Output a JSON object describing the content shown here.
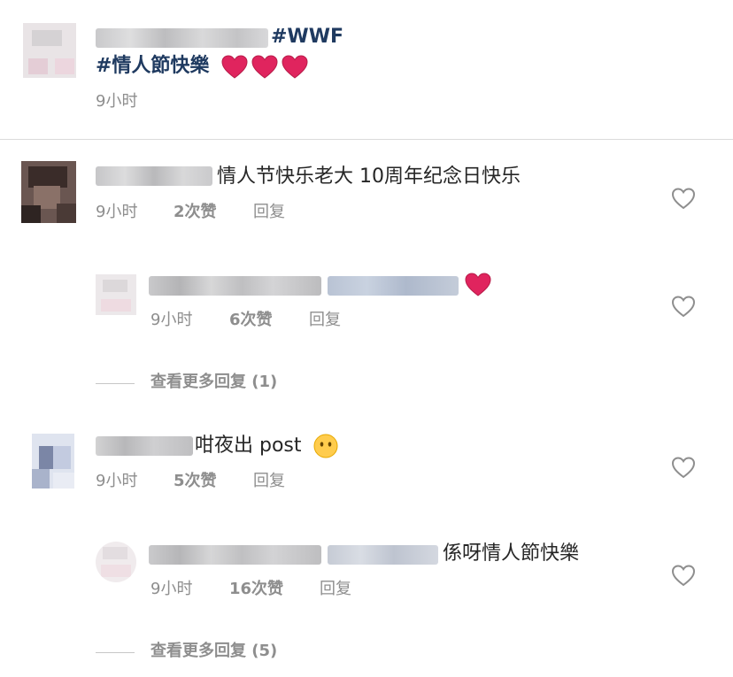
{
  "post": {
    "hashtag_wwf": "#WWF",
    "hashtag_valentine": "#情人節快樂",
    "time": "9小时"
  },
  "comments": [
    {
      "text": "情人节快乐老大 10周年纪念日快乐",
      "time": "9小时",
      "likes": "2次赞",
      "reply": "回复"
    },
    {
      "time": "9小时",
      "likes": "6次赞",
      "reply": "回复"
    },
    {
      "view_more": "查看更多回复 (1)"
    },
    {
      "text": "咁夜出 post",
      "time": "9小时",
      "likes": "5次赞",
      "reply": "回复"
    },
    {
      "text": "係呀情人節快樂",
      "time": "9小时",
      "likes": "16次赞",
      "reply": "回复"
    },
    {
      "view_more": "查看更多回复 (5)"
    }
  ],
  "icons": {
    "like": "heart-outline-icon",
    "emoji_heart": "red-heart-emoji",
    "emoji_face": "face-without-mouth-emoji"
  },
  "colors": {
    "hashtag": "#1f3a60",
    "meta": "#8e8e8e",
    "heart": "#e0245e"
  }
}
